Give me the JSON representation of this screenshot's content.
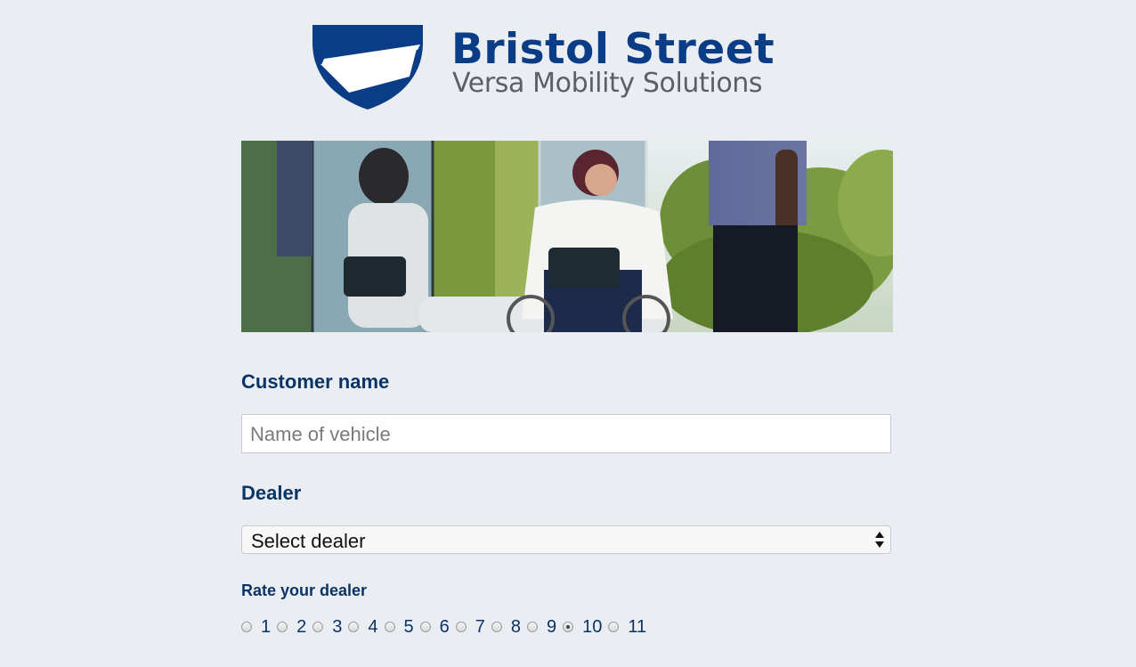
{
  "brand": {
    "name": "Bristol Street",
    "tagline": "Versa Mobility Solutions",
    "colors": {
      "primary": "#0b3d86",
      "tagline": "#5b5f66",
      "label": "#0b3466"
    }
  },
  "hero": {
    "icon": "banner-photo"
  },
  "form": {
    "customer_name": {
      "label": "Customer name",
      "placeholder": "Name of vehicle",
      "value": ""
    },
    "dealer": {
      "label": "Dealer",
      "selected": "Select dealer"
    },
    "rating": {
      "label": "Rate your dealer",
      "options": [
        "1",
        "2",
        "3",
        "4",
        "5",
        "6",
        "7",
        "8",
        "9",
        "10",
        "11"
      ],
      "selected": "10"
    }
  }
}
